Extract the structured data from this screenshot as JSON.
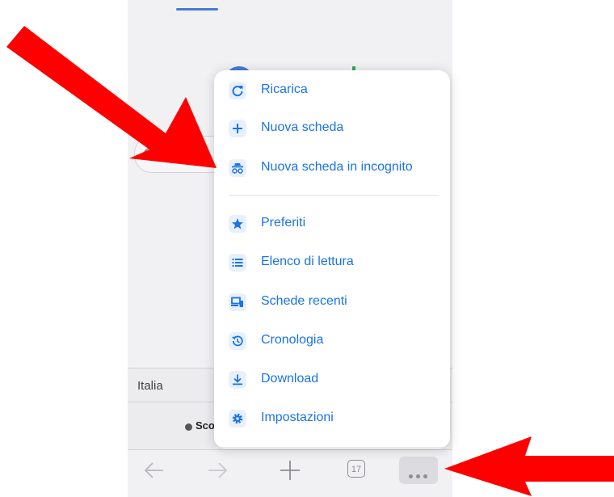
{
  "background": {
    "region_label": "Italia",
    "footer_text": "Sco",
    "search_icon": "search-icon"
  },
  "menu": {
    "items": [
      {
        "label": "Ricarica",
        "icon": "reload-icon"
      },
      {
        "label": "Nuova scheda",
        "icon": "plus-icon"
      },
      {
        "label": "Nuova scheda in incognito",
        "icon": "incognito-icon"
      },
      {
        "label": "Preferiti",
        "icon": "star-icon"
      },
      {
        "label": "Elenco di lettura",
        "icon": "reading-list-icon"
      },
      {
        "label": "Schede recenti",
        "icon": "recent-tabs-icon"
      },
      {
        "label": "Cronologia",
        "icon": "history-icon"
      },
      {
        "label": "Download",
        "icon": "download-icon"
      },
      {
        "label": "Impostazioni",
        "icon": "gear-icon"
      }
    ]
  },
  "toolbar": {
    "tab_count": "17"
  },
  "colors": {
    "accent": "#1a73e8",
    "icon_bg": "#e8f0fe",
    "arrow": "#ff0000"
  }
}
